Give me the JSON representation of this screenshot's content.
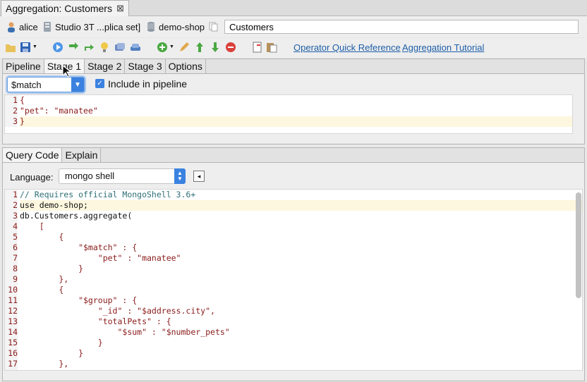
{
  "doc_tab": {
    "title": "Aggregation: Customers",
    "close": "⊠"
  },
  "connection": {
    "user": "alice",
    "server": "Studio 3T ...plica set]",
    "database": "demo-shop",
    "collection": "Customers"
  },
  "toolbar": {
    "links": [
      "Operator Quick Reference",
      "Aggregation Tutorial"
    ],
    "icons": [
      "open-folder-icon",
      "save-icon",
      "run-icon",
      "step-forward-icon",
      "step-to-icon",
      "bulb-icon",
      "explain-icon",
      "layers-icon",
      "add-stage-icon",
      "edit-stage-icon",
      "move-up-icon",
      "move-down-icon",
      "remove-stage-icon",
      "copy-icon",
      "paste-icon"
    ]
  },
  "stage_tabs": [
    {
      "label": "Pipeline",
      "active": false
    },
    {
      "label": "Stage 1",
      "active": true
    },
    {
      "label": "Stage 2",
      "active": false
    },
    {
      "label": "Stage 3",
      "active": false
    },
    {
      "label": "Options",
      "active": false
    }
  ],
  "stage": {
    "operator": "$match",
    "include_label": "Include in pipeline",
    "include_checked": true,
    "code": [
      "{",
      "\"pet\": \"manatee\"",
      "}"
    ]
  },
  "query_tabs": [
    {
      "label": "Query Code",
      "active": true
    },
    {
      "label": "Explain",
      "active": false
    }
  ],
  "language": {
    "label": "Language:",
    "value": "mongo shell"
  },
  "query_code": [
    "// Requires official MongoShell 3.6+",
    "use demo-shop;",
    "db.Customers.aggregate(",
    "    [",
    "        {",
    "            \"$match\" : {",
    "                \"pet\" : \"manatee\"",
    "            }",
    "        },",
    "        {",
    "            \"$group\" : {",
    "                \"_id\" : \"$address.city\",",
    "                \"totalPets\" : {",
    "                    \"$sum\" : \"$number_pets\"",
    "                }",
    "            }",
    "        },"
  ],
  "colors": {
    "accent": "#3b82e0",
    "link": "#1d5ea8",
    "code_red": "#8a1a1a",
    "comment": "#2e6f76",
    "highlight_line": "#fdf7df"
  }
}
